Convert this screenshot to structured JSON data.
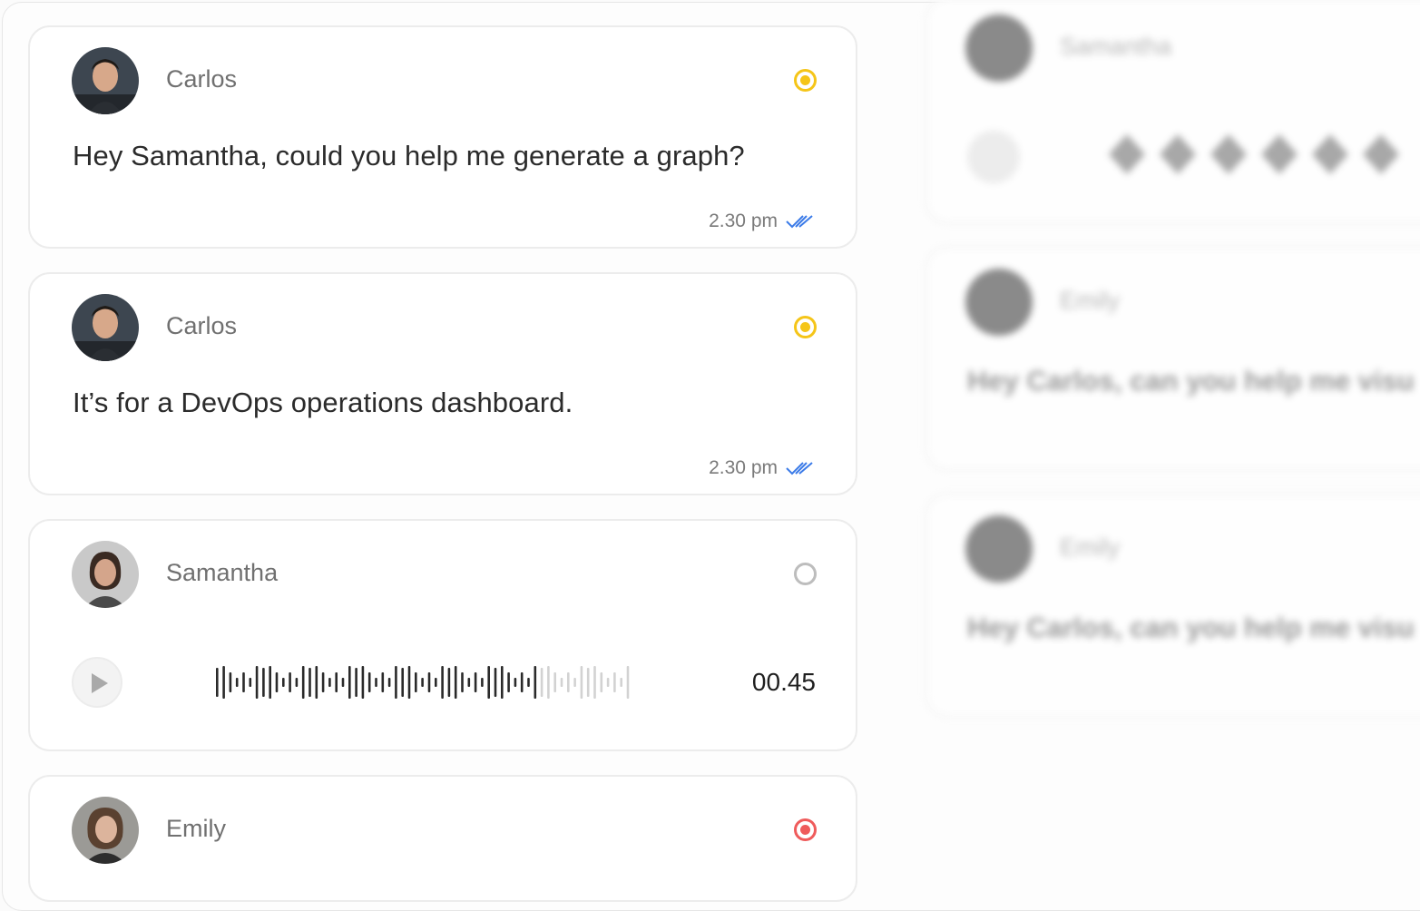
{
  "messages": [
    {
      "name": "Carlos",
      "text": "Hey Samantha, could you help me generate a graph?",
      "time": "2.30 pm",
      "status_color": "#f5c518",
      "avatar": "man"
    },
    {
      "name": "Carlos",
      "text": "It’s for a DevOps operations dashboard.",
      "time": "2.30 pm",
      "status_color": "#f5c518",
      "avatar": "man"
    },
    {
      "name": "Samantha",
      "voice_duration": "00.45",
      "voice_progress": 0.77,
      "status_color": "#bdbdbd",
      "avatar": "woman"
    },
    {
      "name": "Emily",
      "status_color": "#ef5b5b",
      "avatar": "woman2"
    }
  ],
  "ghost": [
    {
      "name": "Samantha"
    },
    {
      "name": "Emily",
      "text": "Hey Carlos, can you help me visu"
    },
    {
      "name": "Emily",
      "text": "Hey Carlos, can you help me visu"
    }
  ],
  "icons": {
    "read_receipt": "double-check-icon",
    "play": "play-icon",
    "status": "status-indicator-icon"
  },
  "colors": {
    "read_receipt": "#3b7be8"
  }
}
